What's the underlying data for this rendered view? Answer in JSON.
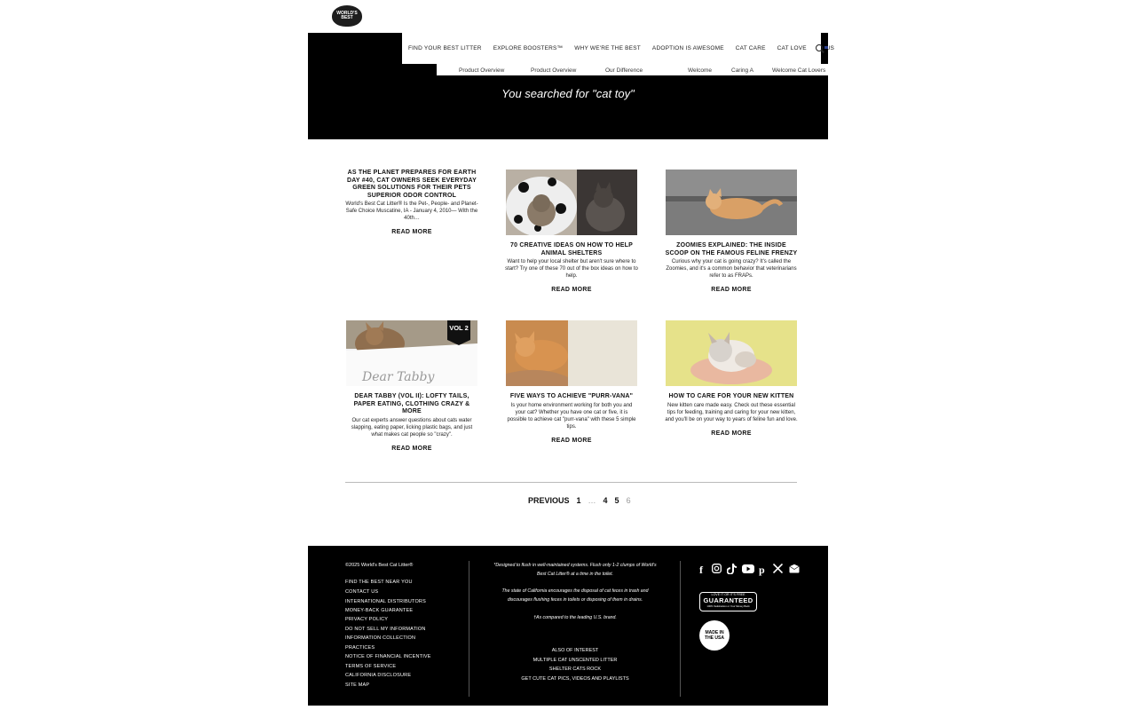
{
  "logo": {
    "text": "WORLD'S BEST"
  },
  "nav": {
    "items": [
      "FIND YOUR BEST LITTER",
      "EXPLORE BOOSTERS™",
      "WHY WE'RE THE BEST",
      "ADOPTION IS AWESOME",
      "CAT CARE",
      "CAT LOVE"
    ],
    "country": "US"
  },
  "subnav": [
    "Product Overview",
    "Product Overview",
    "Our Difference",
    "Welcome",
    "Caring A",
    "Welcome Cat Lovers"
  ],
  "search_result": "You searched for \"cat toy\"",
  "cards": [
    {
      "title": "As the Planet Prepares for Earth Day #40, Cat Owners Seek Everyday Green Solutions for their Pets Superior Odor Control",
      "excerpt": "World's Best Cat Litter® Is the Pet-, People- and Planet-Safe Choice Muscatine, IA - January 4, 2010— With the 40th…",
      "cta": "READ MORE"
    },
    {
      "title": "70 Creative Ideas on How to Help Animal Shelters",
      "excerpt": "Want to help your local shelter but aren't sure where to start? Try one of these 70 out of the box ideas on how to help.",
      "cta": "READ MORE"
    },
    {
      "title": "Zoomies Explained: The Inside Scoop on the Famous Feline Frenzy",
      "excerpt": "Curious why your cat is going crazy? It's called the Zoomies, and it's a common behavior that veterinarians refer to as FRAPs.",
      "cta": "READ MORE"
    },
    {
      "title": "Dear Tabby (Vol II): Lofty Tails, Paper Eating, Clothing Crazy & More",
      "excerpt": "Our cat experts answer questions about cats water slapping, eating paper, licking plastic bags, and just what makes cat people so \"crazy\".",
      "cta": "READ MORE",
      "badge": "VOL 2",
      "overlay": "Dear Tabby"
    },
    {
      "title": "Five Ways to Achieve \"Purr-vana\"",
      "excerpt": "Is your home environment working for both you and your cat? Whether you have one cat or five, it is possible to achieve cat \"purr-vana\" with these 5 simple tips.",
      "cta": "READ MORE"
    },
    {
      "title": "How to Care for Your New Kitten",
      "excerpt": "New kitten care made easy. Check out these essential tips for feeding, training and caring for your new kitten, and you'll be on your way to years of feline fun and love.",
      "cta": "READ MORE"
    }
  ],
  "pager": {
    "prev": "PREVIOUS",
    "pages": [
      "1",
      "…",
      "4",
      "5",
      "6"
    ]
  },
  "footer": {
    "copyright": "©2025 World's Best Cat Litter®",
    "links": [
      "FIND THE BEST NEAR YOU",
      "CONTACT US",
      "INTERNATIONAL DISTRIBUTORS",
      "MONEY-BACK GUARANTEE",
      "PRIVACY POLICY",
      "DO NOT SELL MY INFORMATION",
      "INFORMATION COLLECTION",
      "PRACTICES",
      "NOTICE OF FINANCIAL INCENTIVE",
      "TERMS OF SERVICE",
      "CALIFORNIA DISCLOSURE",
      "SITE MAP"
    ],
    "notes": [
      "*Designed to flush in well-maintained systems. Flush only 1-2 clumps of World's Best Cat Litter® at a time in the toilet.",
      "The state of California encourages the disposal of cat feces in trash and discourages flushing feces in toilets or disposing of them in drains.",
      "†As compared to the leading U.S. brand."
    ],
    "mid_links": [
      "ALSO OF INTEREST",
      "MULTIPLE CAT UNSCENTED LITTER",
      "SHELTER CATS ROCK",
      "GET CUTE CAT PICS, VIDEOS AND PLAYLISTS"
    ],
    "guarantee": "GUARANTEED",
    "guarantee_top": "LOVE IT OR IT'S FREE",
    "guarantee_sub": "100% Satisfaction or Your Money Back",
    "usa": "MADE IN THE USA"
  }
}
